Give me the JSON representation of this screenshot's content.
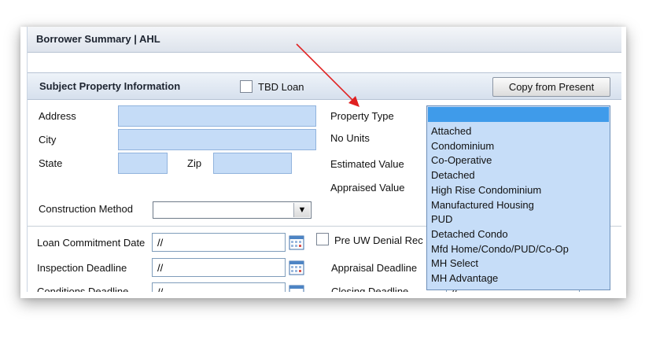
{
  "window": {
    "title": "Borrower Summary | AHL"
  },
  "section": {
    "title": "Subject Property Information",
    "tbd_label": "TBD Loan",
    "copy_button": "Copy from Present"
  },
  "labels": {
    "address": "Address",
    "city": "City",
    "state": "State",
    "zip": "Zip",
    "property_type": "Property Type",
    "no_units": "No Units",
    "estimated_value": "Estimated Value",
    "appraised_value": "Appraised Value",
    "construction_method": "Construction Method",
    "loan_commitment_date": "Loan Commitment Date",
    "inspection_deadline": "Inspection Deadline",
    "conditions_deadline": "Conditions Deadline",
    "pre_uw_denial": "Pre UW Denial Rec",
    "appraisal_deadline": "Appraisal Deadline",
    "closing_deadline": "Closing Deadline"
  },
  "dates": {
    "loan_commitment": "//",
    "inspection": "//",
    "conditions": "//",
    "closing": "//"
  },
  "property_type_options": [
    "Attached",
    "Condominium",
    "Co-Operative",
    "Detached",
    "High Rise Condominium",
    "Manufactured Housing",
    "PUD",
    "Detached Condo",
    "Mfd Home/Condo/PUD/Co-Op",
    "MH Select",
    "MH Advantage"
  ],
  "colors": {
    "field_fill": "#c5dcf7",
    "selected_option": "#3f9bea",
    "annotation_arrow": "#e02020"
  },
  "icons": {
    "calendar": "calendar-icon",
    "dropdown": "chevron-down-icon"
  }
}
